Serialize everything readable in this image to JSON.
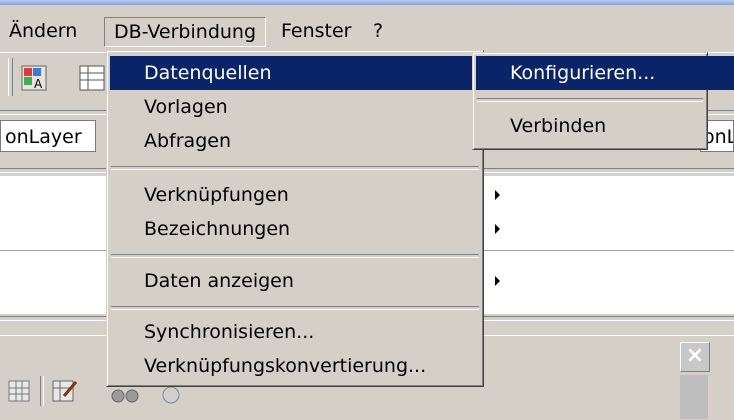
{
  "menubar": {
    "items": [
      "Ändern",
      "DB-Verbindung",
      "Fenster",
      "?"
    ]
  },
  "layer_combo": {
    "value": "onLayer"
  },
  "layer_combo_right": {
    "value": "onL"
  },
  "db_menu": {
    "items": [
      {
        "label": "Datenquellen",
        "submenu": true,
        "highlighted": true
      },
      {
        "label": "Vorlagen",
        "submenu": true
      },
      {
        "label": "Abfragen",
        "submenu": true
      },
      {
        "label": "Verknüpfungen",
        "submenu": true
      },
      {
        "label": "Bezeichnungen",
        "submenu": true
      },
      {
        "label": "Daten anzeigen",
        "submenu": true
      },
      {
        "label": "Synchronisieren...",
        "submenu": false
      },
      {
        "label": "Verknüpfungskonvertierung...",
        "submenu": false
      }
    ]
  },
  "sub_menu": {
    "items": [
      {
        "label": "Konfigurieren...",
        "highlighted": true
      },
      {
        "label": "Verbinden"
      }
    ]
  },
  "icons": [
    "attribute-icon",
    "table-icon",
    "grid-icon",
    "edit-icon",
    "binoculars-icon",
    "globe-icon",
    "close-icon"
  ],
  "colors": {
    "highlight": "#0a246a",
    "face": "#d4d0c8"
  }
}
